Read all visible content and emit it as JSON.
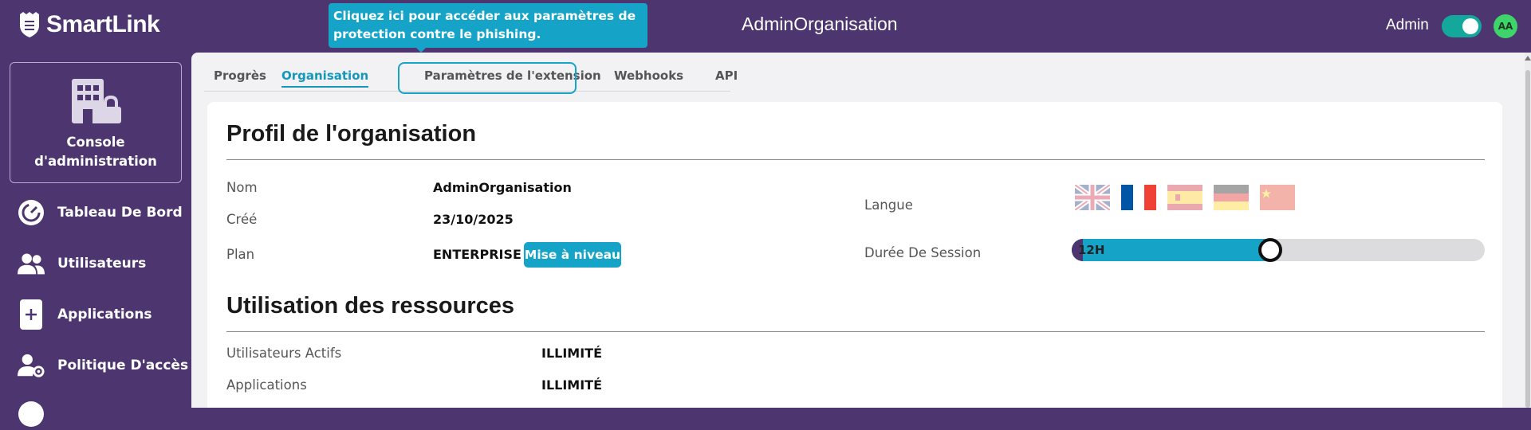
{
  "app": {
    "name": "SmartLink"
  },
  "header": {
    "org_title": "AdminOrganisation",
    "admin_label": "Admin",
    "avatar_initials": "AA",
    "toggle_on": true
  },
  "tooltip": {
    "text": "Cliquez ici pour accéder aux paramètres de protection contre le phishing."
  },
  "sidebar": {
    "console_label": "Console d'administration",
    "items": [
      {
        "label": "Tableau De Bord",
        "icon": "gauge-icon"
      },
      {
        "label": "Utilisateurs",
        "icon": "users-icon"
      },
      {
        "label": "Applications",
        "icon": "plus-square-icon"
      },
      {
        "label": "Politique D'accès",
        "icon": "user-gear-icon"
      }
    ]
  },
  "tabs": [
    {
      "label": "Progrès"
    },
    {
      "label": "Organisation",
      "active": true
    },
    {
      "label": "Paramètres de l'extension"
    },
    {
      "label": "Webhooks"
    },
    {
      "label": "API"
    }
  ],
  "profile": {
    "title": "Profil de l'organisation",
    "name_label": "Nom",
    "name_value": "AdminOrganisation",
    "created_label": "Créé",
    "created_value": "23/10/2025",
    "plan_label": "Plan",
    "plan_value": "ENTERPRISE",
    "upgrade_label": "Mise à niveau",
    "language_label": "Langue",
    "flags": [
      {
        "name": "uk-flag-icon",
        "selected": false
      },
      {
        "name": "france-flag-icon",
        "selected": true
      },
      {
        "name": "spain-flag-icon",
        "selected": false
      },
      {
        "name": "germany-flag-icon",
        "selected": false
      },
      {
        "name": "china-flag-icon",
        "selected": false
      }
    ],
    "session_label": "Durée De Session",
    "session_value": "12H",
    "session_level": 0.48
  },
  "resources": {
    "title": "Utilisation des ressources",
    "rows": [
      {
        "label": "Utilisateurs Actifs",
        "value": "ILLIMITÉ"
      },
      {
        "label": "Applications",
        "value": "ILLIMITÉ"
      }
    ]
  },
  "colors": {
    "brand": "#4d3570",
    "accent": "#15a4c8",
    "toggle": "#14a79c",
    "avatar": "#3ed46b"
  }
}
